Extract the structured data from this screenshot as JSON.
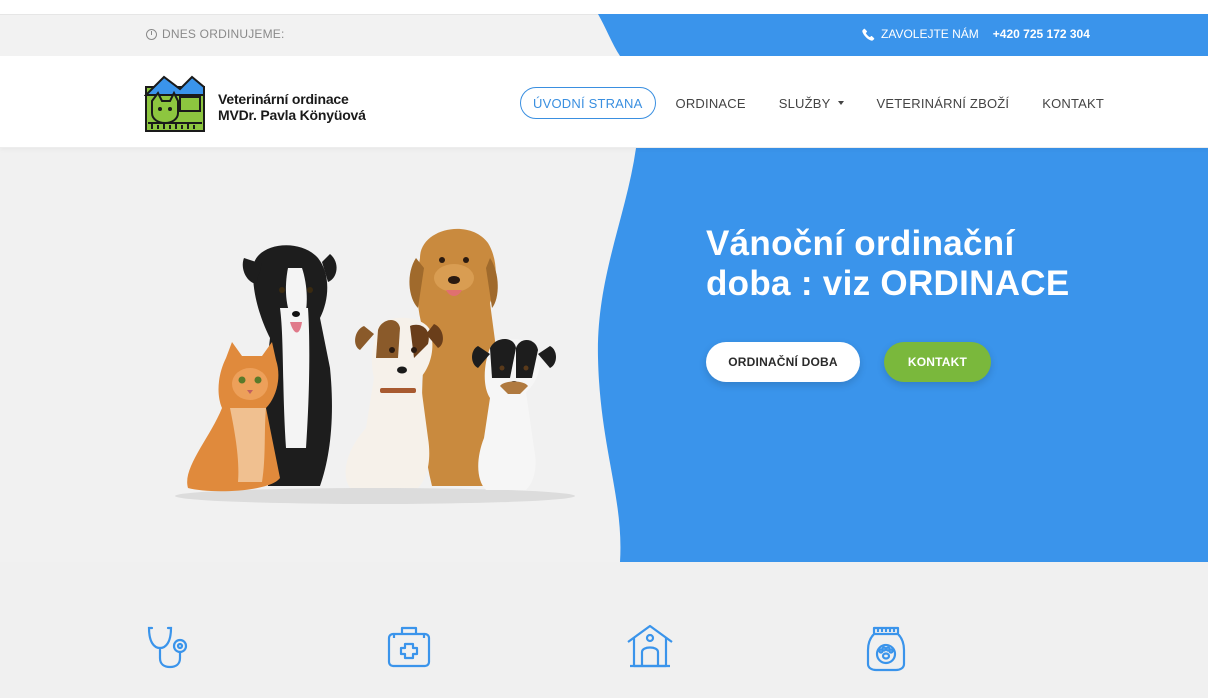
{
  "topbar": {
    "open_today_label": "DNES ORDINUJEME:",
    "call_label": "ZAVOLEJTE NÁM",
    "phone": "+420 725 172 304"
  },
  "header": {
    "brand_line1": "Veterinární ordinace",
    "brand_line2": "MVDr. Pavla Könyüová",
    "nav": [
      {
        "label": "ÚVODNÍ STRANA"
      },
      {
        "label": "ORDINACE"
      },
      {
        "label": "SLUŽBY"
      },
      {
        "label": "VETERINÁRNÍ ZBOŽÍ"
      },
      {
        "label": "KONTAKT"
      }
    ]
  },
  "hero": {
    "title_line1": "Vánoční ordinační",
    "title_line2": "doba : viz ORDINACE",
    "button_hours": "ORDINAČNÍ DOBA",
    "button_contact": "KONTAKT"
  },
  "features": {
    "icons": [
      "stethoscope-icon",
      "first-aid-kit-icon",
      "dog-house-icon",
      "pet-food-icon"
    ]
  },
  "colors": {
    "accent_blue": "#3a94eb",
    "green": "#7ab83c",
    "nav_active": "#3a8fe0",
    "icon_blue": "#3a94eb"
  }
}
